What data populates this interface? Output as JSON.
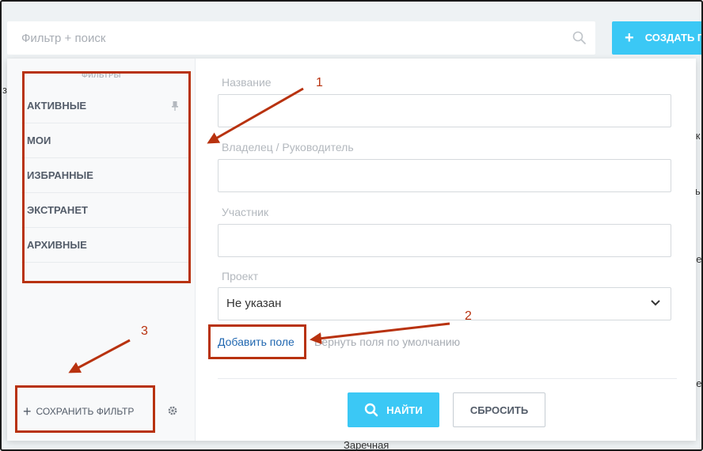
{
  "search": {
    "placeholder": "Фильтр + поиск",
    "create_label": "СОЗДАТЬ П"
  },
  "background": {
    "bottom_text": "Заречная",
    "right_fragments": [
      "ьк",
      "ть",
      "ре",
      "ре"
    ],
    "left_fragments": [
      "з,"
    ]
  },
  "sidebar": {
    "caption": "ФИЛЬТРЫ",
    "items": [
      {
        "label": "АКТИВНЫЕ",
        "pinned": true
      },
      {
        "label": "МОИ"
      },
      {
        "label": "ИЗБРАННЫЕ"
      },
      {
        "label": "ЭКСТРАНЕТ"
      },
      {
        "label": "АРХИВНЫЕ"
      }
    ],
    "save_filter_label": "СОХРАНИТЬ ФИЛЬТР"
  },
  "form": {
    "fields": [
      {
        "label": "Название",
        "value": ""
      },
      {
        "label": "Владелец / Руководитель",
        "value": ""
      },
      {
        "label": "Участник",
        "value": ""
      }
    ],
    "project": {
      "label": "Проект",
      "value": "Не указан"
    },
    "add_field_label": "Добавить поле",
    "reset_fields_label": "Вернуть поля по умолчанию",
    "find_label": "НАЙТИ",
    "reset_label": "СБРОСИТЬ"
  },
  "annotations": {
    "numbers": [
      "1",
      "2",
      "3"
    ],
    "color": "#b8320f"
  },
  "colors": {
    "accent": "#3bc8f5",
    "link": "#2067b0"
  }
}
